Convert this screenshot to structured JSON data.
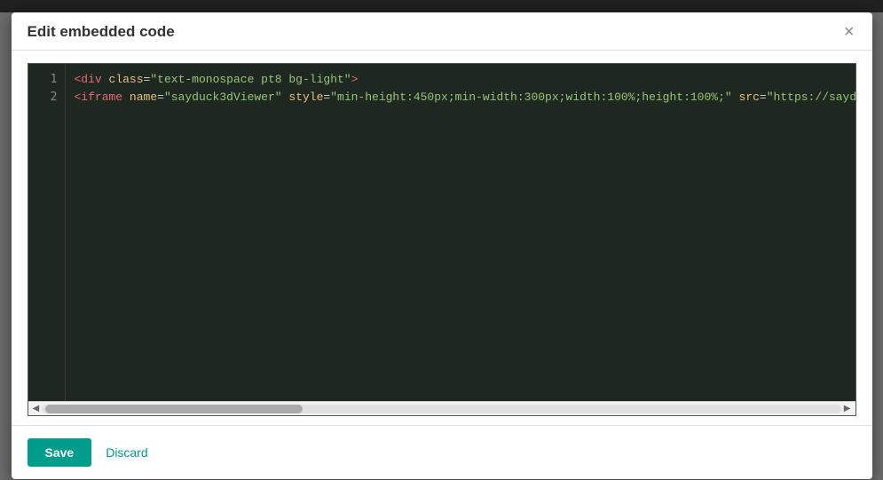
{
  "modal": {
    "title": "Edit embedded code",
    "close_label": "×"
  },
  "footer": {
    "save_label": "Save",
    "discard_label": "Discard"
  },
  "code_editor": {
    "lines": [
      {
        "number": "1",
        "html": "<span class='tag'>&lt;div</span> <span class='attr-name'>class</span>=<span class='attr-value'>\"text-monospace pt8 bg-light\"</span><span class='tag'>&gt;</span>"
      },
      {
        "number": "2",
        "html": "<span class='tag'>&lt;iframe</span> <span class='attr-name'>name</span>=<span class='attr-value'>\"sayduck3dViewer\"</span> <span class='attr-name'>style</span>=<span class='attr-value'>\"min-height:450px;min-width:300px;width:100%;height:100%;\"</span> <span class='attr-name'>src</span>=<span class='attr-value'>\"https://sayduck.</span>"
      }
    ]
  },
  "icons": {
    "close": "×",
    "arrow_left": "◀",
    "arrow_right": "▶"
  }
}
